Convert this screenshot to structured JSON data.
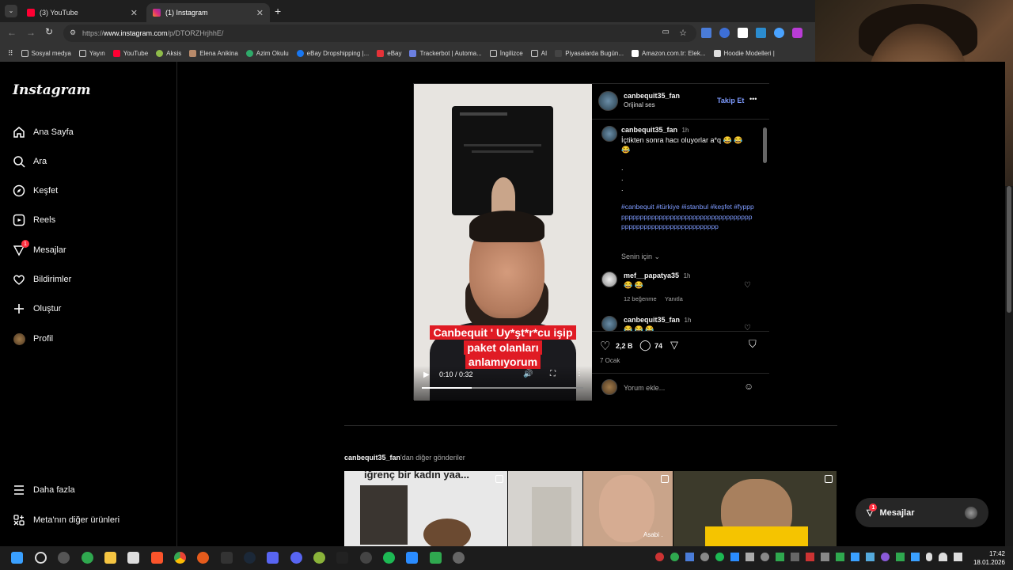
{
  "browser": {
    "tabs": [
      {
        "title": "(3) YouTube",
        "color": "#ff0033"
      },
      {
        "title": "(1) Instagram",
        "color": "#e1306c"
      }
    ],
    "url_prefix": "https://",
    "url_host": "www.instagram.com",
    "url_path": "/p/DTORZHrjhhE/",
    "new_tab_label": "+",
    "bookmarks": [
      "Sosyal medya",
      "Yayın",
      "YouTube",
      "Aksis",
      "Elena Anikina",
      "Azim Okulu",
      "eBay Dropshipping |...",
      "eBay",
      "Trackerbot | Automa...",
      "İngilizce",
      "AI",
      "Piyasalarda Bugün...",
      "Amazon.com.tr: Elek...",
      "Hoodie Modelleri |"
    ]
  },
  "sidebar": {
    "logo": "Instagram",
    "items": [
      {
        "label": "Ana Sayfa",
        "icon": "home-icon"
      },
      {
        "label": "Ara",
        "icon": "search-icon"
      },
      {
        "label": "Keşfet",
        "icon": "compass-icon"
      },
      {
        "label": "Reels",
        "icon": "reels-icon"
      },
      {
        "label": "Mesajlar",
        "icon": "messenger-icon",
        "badge": "1"
      },
      {
        "label": "Bildirimler",
        "icon": "heart-icon"
      },
      {
        "label": "Oluştur",
        "icon": "plus-icon"
      },
      {
        "label": "Profil",
        "icon": "avatar"
      }
    ],
    "bottom": [
      {
        "label": "Daha fazla",
        "icon": "menu-icon"
      },
      {
        "label": "Meta'nın diğer ürünleri",
        "icon": "meta-icon"
      }
    ]
  },
  "post": {
    "video": {
      "caption_lines": [
        "Canbequit ' Uy*şt*r*cu işip",
        "paket olanları",
        "anlamıyorum"
      ],
      "time": "0:10 / 0:32",
      "progress": 0.31
    },
    "header": {
      "username": "canbequit35_fan",
      "subtitle": "Orijinal ses",
      "follow": "Takip Et",
      "more": "•••"
    },
    "caption": {
      "username": "canbequit35_fan",
      "time": "1h",
      "text": "İçtikten sonra hacı oluyorlar a*q 😂 😂 😂",
      "dots": [
        ".",
        ".",
        "."
      ],
      "hashtags": "#canbequit #türkiye #istanbul #keşfet #fypppppppppppppppppppppppppppppppppppppppppppppppppppppppppppppppp"
    },
    "for_you": "Senin için",
    "comments": [
      {
        "username": "mef__papatya35",
        "time": "1h",
        "text": "😂 😂",
        "likes": "12 beğenme",
        "reply": "Yanıtla"
      },
      {
        "username": "canbequit35_fan",
        "time": "1h",
        "text": "😂 😂 😂",
        "likes": "",
        "reply": ""
      }
    ],
    "likes_count": "2,2 B",
    "comments_count": "74",
    "date": "7 Ocak",
    "add_comment_placeholder": "Yorum ekle..."
  },
  "more_posts": {
    "username": "canbequit35_fan",
    "suffix": "'dan diğer gönderiler",
    "first_caption": "iğrenç bir kadın yaa...",
    "third_caption": "Asabi ."
  },
  "messages_pill": {
    "label": "Mesajlar",
    "badge": "1"
  },
  "taskbar": {
    "time": "17:42",
    "date": "18.01.2026"
  }
}
